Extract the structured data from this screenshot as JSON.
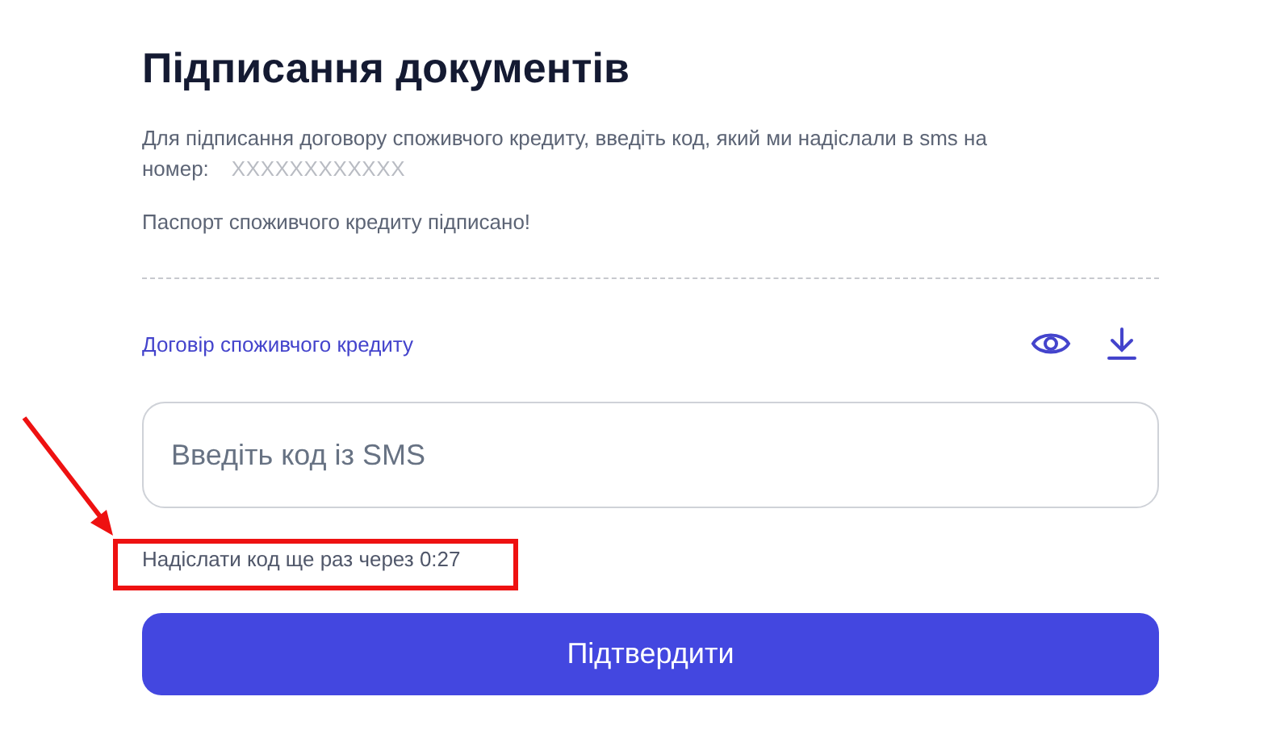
{
  "title": "Підписання документів",
  "description": "Для підписання договору споживчого кредиту, введіть код, який ми надіслали в sms на номер:",
  "phone": "XXXXXXXXXXXX",
  "status": "Паспорт споживчого кредиту підписано!",
  "document": {
    "label": "Договір споживчого кредиту"
  },
  "code_field": {
    "placeholder": "Введіть код із SMS"
  },
  "resend_text": "Надіслати код ще раз через 0:27",
  "submit_button": "Підтвердити"
}
